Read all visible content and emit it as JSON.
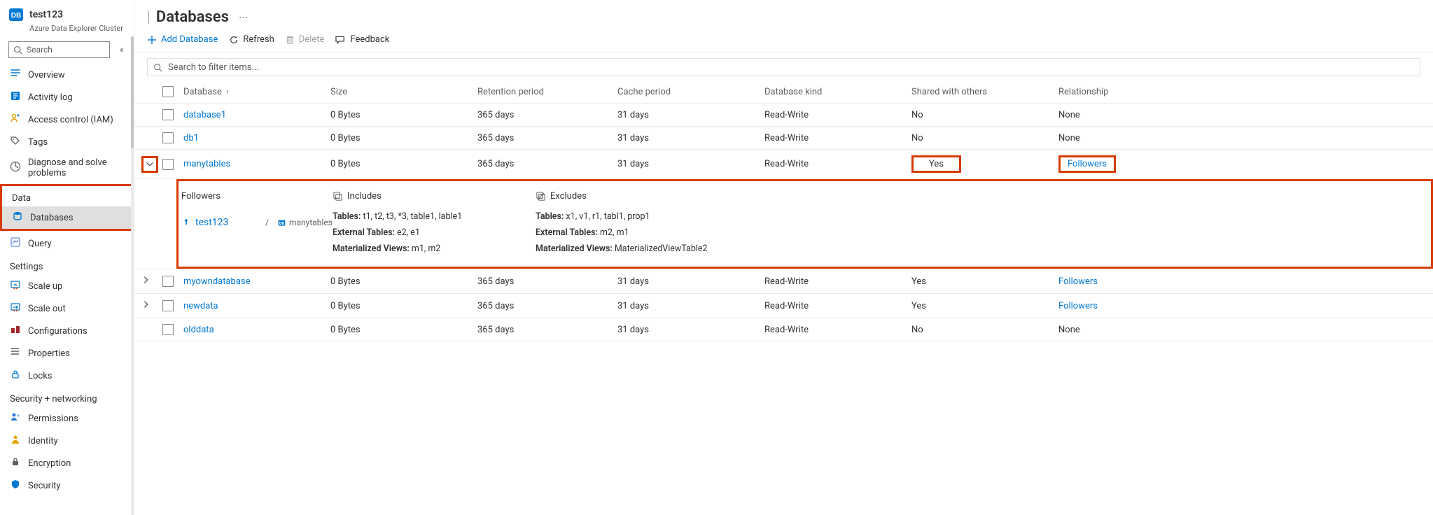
{
  "resource": {
    "name": "test123",
    "type": "Azure Data Explorer Cluster"
  },
  "search": {
    "placeholder": "Search"
  },
  "collapse_glyph": "«",
  "nav": {
    "top": [
      {
        "icon": "overview",
        "label": "Overview"
      },
      {
        "icon": "activity",
        "label": "Activity log"
      },
      {
        "icon": "iam",
        "label": "Access control (IAM)"
      },
      {
        "icon": "tags",
        "label": "Tags"
      },
      {
        "icon": "diagnose",
        "label": "Diagnose and solve problems"
      }
    ],
    "sections": [
      {
        "title": "Data",
        "highlighted": true,
        "items": [
          {
            "icon": "database",
            "label": "Databases",
            "selected": true
          },
          {
            "icon": "query",
            "label": "Query"
          }
        ]
      },
      {
        "title": "Settings",
        "items": [
          {
            "icon": "scaleup",
            "label": "Scale up"
          },
          {
            "icon": "scaleout",
            "label": "Scale out"
          },
          {
            "icon": "config",
            "label": "Configurations"
          },
          {
            "icon": "props",
            "label": "Properties"
          },
          {
            "icon": "locks",
            "label": "Locks"
          }
        ]
      },
      {
        "title": "Security + networking",
        "items": [
          {
            "icon": "perms",
            "label": "Permissions"
          },
          {
            "icon": "identity",
            "label": "Identity"
          },
          {
            "icon": "encrypt",
            "label": "Encryption"
          },
          {
            "icon": "security",
            "label": "Security"
          }
        ]
      }
    ]
  },
  "page": {
    "title": "Databases"
  },
  "commands": {
    "add": "Add Database",
    "refresh": "Refresh",
    "delete": "Delete",
    "feedback": "Feedback"
  },
  "filter": {
    "placeholder": "Search to filter items..."
  },
  "columns": {
    "name": "Database",
    "sort_glyph": "↑",
    "size": "Size",
    "ret": "Retention period",
    "cache": "Cache period",
    "kind": "Database kind",
    "shared": "Shared with others",
    "rel": "Relationship"
  },
  "rows": [
    {
      "name": "database1",
      "size": "0 Bytes",
      "ret": "365 days",
      "cache": "31 days",
      "kind": "Read-Write",
      "shared": "No",
      "rel": "None",
      "rel_link": false,
      "expandable": false,
      "expanded": false
    },
    {
      "name": "db1",
      "size": "0 Bytes",
      "ret": "365 days",
      "cache": "31 days",
      "kind": "Read-Write",
      "shared": "No",
      "rel": "None",
      "rel_link": false,
      "expandable": false,
      "expanded": false
    },
    {
      "name": "manytables",
      "size": "0 Bytes",
      "ret": "365 days",
      "cache": "31 days",
      "kind": "Read-Write",
      "shared": "Yes",
      "rel": "Followers",
      "rel_link": true,
      "expandable": true,
      "expanded": true,
      "highlighted": true
    },
    {
      "name": "myowndatabase",
      "size": "0 Bytes",
      "ret": "365 days",
      "cache": "31 days",
      "kind": "Read-Write",
      "shared": "Yes",
      "rel": "Followers",
      "rel_link": true,
      "expandable": true,
      "expanded": false
    },
    {
      "name": "newdata",
      "size": "0 Bytes",
      "ret": "365 days",
      "cache": "31 days",
      "kind": "Read-Write",
      "shared": "Yes",
      "rel": "Followers",
      "rel_link": true,
      "expandable": true,
      "expanded": false
    },
    {
      "name": "olddata",
      "size": "0 Bytes",
      "ret": "365 days",
      "cache": "31 days",
      "kind": "Read-Write",
      "shared": "No",
      "rel": "None",
      "rel_link": false,
      "expandable": false,
      "expanded": false
    }
  ],
  "details": {
    "followers_heading": "Followers",
    "includes_heading": "Includes",
    "excludes_heading": "Excludes",
    "follower_cluster": "test123",
    "follower_sep": "/",
    "follower_db": "manytables",
    "includes": {
      "tables_label": "Tables:",
      "tables": "t1, t2, t3, *3, table1, lable1",
      "ext_label": "External Tables:",
      "ext": "e2, e1",
      "mv_label": "Materialized Views:",
      "mv": "m1, m2"
    },
    "excludes": {
      "tables_label": "Tables:",
      "tables": "x1, v1, r1, tabl1, prop1",
      "ext_label": "External Tables:",
      "ext": "m2, m1",
      "mv_label": "Materialized Views:",
      "mv": "MaterializedViewTable2"
    }
  },
  "colors": {
    "highlight": "#d83b01",
    "link": "#0078d4"
  }
}
